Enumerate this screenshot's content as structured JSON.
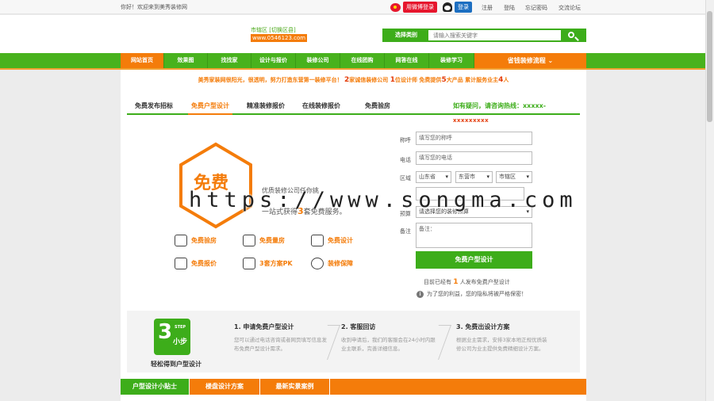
{
  "topbar": {
    "welcome": "你好！欢迎来到美秀装修网",
    "weibo_login": "用微博登录",
    "qq_login": "登录",
    "links": [
      "注册",
      "登陆",
      "忘记密码",
      "交流论坛"
    ]
  },
  "header": {
    "city": "市辖区 [切换区县]",
    "site": "www.0546123.com",
    "search_category": "选择类别",
    "search_placeholder": "请输入搜索关键字"
  },
  "nav": {
    "items": [
      "网站首页",
      "效果图",
      "找找家",
      "设计与报价",
      "装修公司",
      "在线团购",
      "网答在线",
      "装修学习"
    ],
    "process": "省钱装修流程"
  },
  "main": {
    "slogan_pre": "美秀家装网很阳光，很透明，努力打造东营第一装修平台！",
    "slogan_n1": "2",
    "slogan_t1": "家诚信装修公司",
    "slogan_n2": "1",
    "slogan_t2": "位设计师 免费提供",
    "slogan_n3": "5",
    "slogan_t3": "大产品 累计服务业主",
    "slogan_n4": "4",
    "slogan_t4": "人",
    "tabs": [
      "免费发布招标",
      "免费户型设计",
      "精准装修报价",
      "在线装修报价",
      "免费验房"
    ],
    "hotline": "如有疑问，请咨询热线：xxxxx-",
    "hotnum": "xxxxxxxxx",
    "free_badge": "免费",
    "tagline": "优质装修公司任你挑",
    "tagline2_pre": "一站式获得",
    "tagline2_num": "3",
    "tagline2_post": "套免费服务。",
    "features": [
      "免费验房",
      "免费量房",
      "免费设计",
      "免费报价",
      "3套方案PK",
      "装修保障"
    ]
  },
  "form": {
    "name_label": "称呼",
    "name_placeholder": "填写您的称呼",
    "phone_label": "电话",
    "phone_placeholder": "填写您的电话",
    "area_label": "区域",
    "province": "山东省",
    "city": "东营市",
    "district": "市辖区",
    "budget_label": "预算",
    "budget_value": "请选择您的装修预算",
    "note_label": "备注",
    "note_placeholder": "备注：",
    "submit": "免费户型设计",
    "count_pre": "目前已经有",
    "count_num": "1",
    "count_post": "人发布免费户型设计",
    "privacy": "为了您的利益，您的隐私将被严格保密！"
  },
  "steps": {
    "badge_num": "3",
    "badge_step": "STEP",
    "badge_text": "小步",
    "caption": "轻松得到户型设计",
    "items": [
      {
        "title": "1. 申请免费户型设计",
        "desc": "您可以通过电话咨询或者网页填写信息发布免费户型设计需求。"
      },
      {
        "title": "2. 客服回访",
        "desc": "收到申请后，我们的客服会在24小时内跟业主联系，完善详细信息。"
      },
      {
        "title": "3. 免费出设计方案",
        "desc": "根据业主需求，安排3家本地正规优质装修公司为业主提供免费精细设计方案。"
      }
    ]
  },
  "bottom_tabs": [
    "户型设计小贴士",
    "楼盘设计方案",
    "最新实景案例"
  ],
  "watermark": "https://www.songma.com",
  "colors": {
    "green": "#3dad1a",
    "orange": "#f47c0a",
    "red": "#e43d0b"
  }
}
